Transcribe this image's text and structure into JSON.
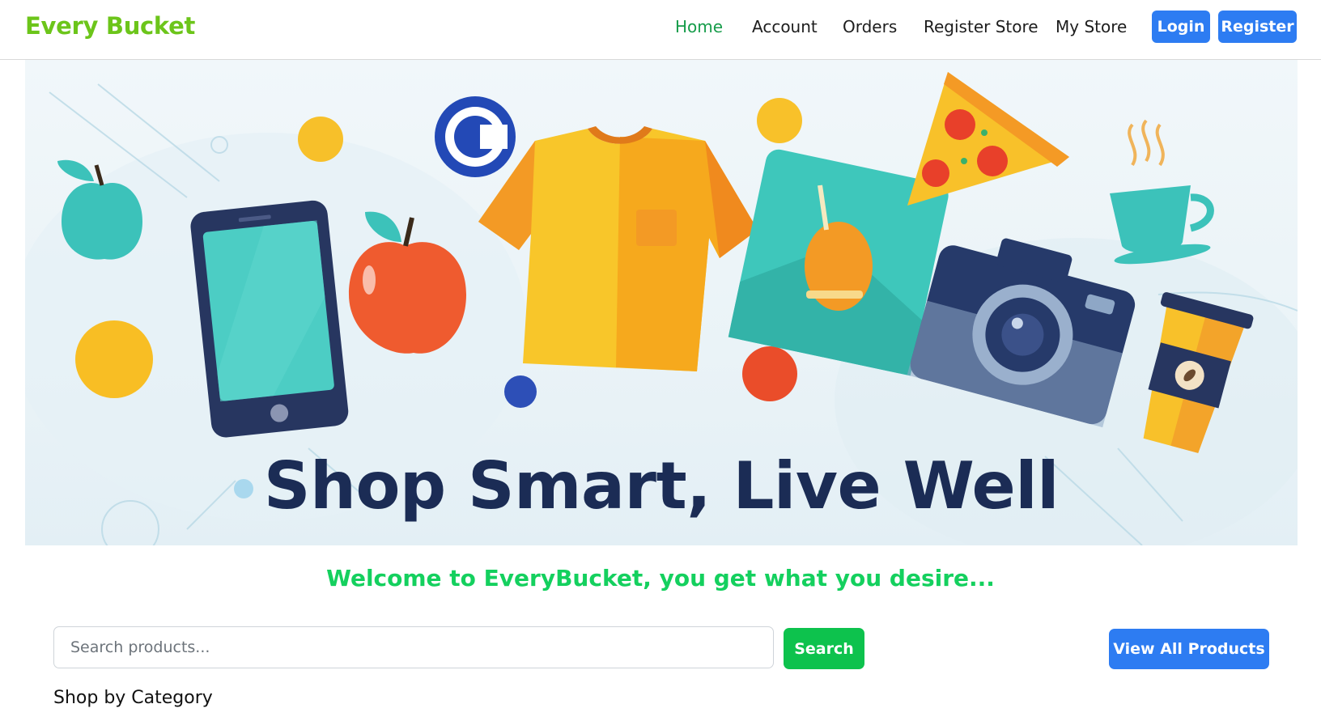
{
  "nav": {
    "brand": "Every Bucket",
    "links": [
      {
        "label": "Home",
        "active": true
      },
      {
        "label": "Account",
        "active": false
      },
      {
        "label": "Orders",
        "active": false
      },
      {
        "label": "Register Store",
        "active": false
      },
      {
        "label": "My Store",
        "active": false
      }
    ],
    "login_label": "Login",
    "register_label": "Register"
  },
  "hero": {
    "title": "Shop Smart, Live Well"
  },
  "welcome": "Welcome to EveryBucket, you get what you desire...",
  "search": {
    "placeholder": "Search products...",
    "value": "",
    "button_label": "Search"
  },
  "view_all_label": "View All Products",
  "category_section_title": "Shop by Category",
  "colors": {
    "brand": "#6cc51a",
    "active_nav": "#169c4a",
    "primary_button": "#2d7cf2",
    "search_button": "#0dc24d",
    "welcome_text": "#14d05e",
    "hero_title": "#1b2c55"
  }
}
